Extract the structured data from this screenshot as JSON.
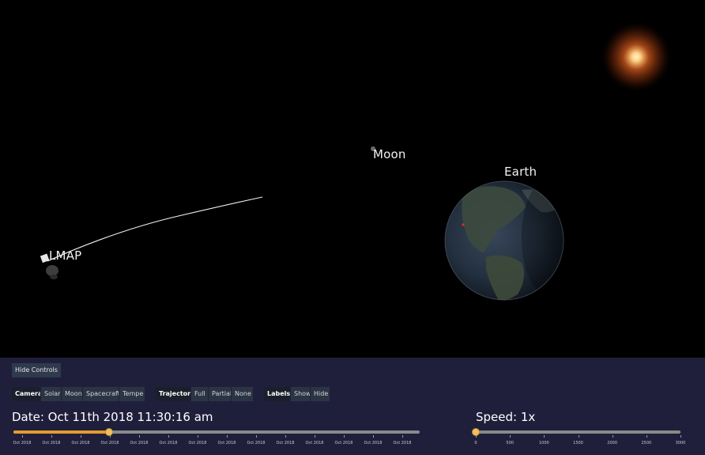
{
  "scene": {
    "labels": {
      "moon": "Moon",
      "earth": "Earth",
      "spacecraft": "LMAP"
    }
  },
  "controls": {
    "hide_controls": "Hide Controls",
    "camera": {
      "title": "Camera",
      "options": [
        "Solar",
        "Moon",
        "Spacecraft",
        "Tempe"
      ]
    },
    "trajectory": {
      "title": "Trajectory",
      "options": [
        "Full",
        "Partial",
        "None"
      ]
    },
    "labels_group": {
      "title": "Labels",
      "options": [
        "Show",
        "Hide"
      ]
    },
    "date_text": "Date: Oct 11th 2018 11:30:16 am",
    "date_slider": {
      "value_fraction": 0.235,
      "tick_labels": [
        "Oct 2018",
        "Oct 2018",
        "Oct 2018",
        "Oct 2018",
        "Oct 2018",
        "Oct 2018",
        "Oct 2018",
        "Oct 2018",
        "Oct 2018",
        "Oct 2018",
        "Oct 2018",
        "Oct 2018",
        "Oct 2018",
        "Oct 2018"
      ]
    },
    "speed_text": "Speed: 1x",
    "speed_slider": {
      "value": 1,
      "min": 0,
      "max": 3000,
      "tick_labels": [
        "0",
        "500",
        "1000",
        "1500",
        "2000",
        "2500",
        "3000"
      ]
    }
  }
}
